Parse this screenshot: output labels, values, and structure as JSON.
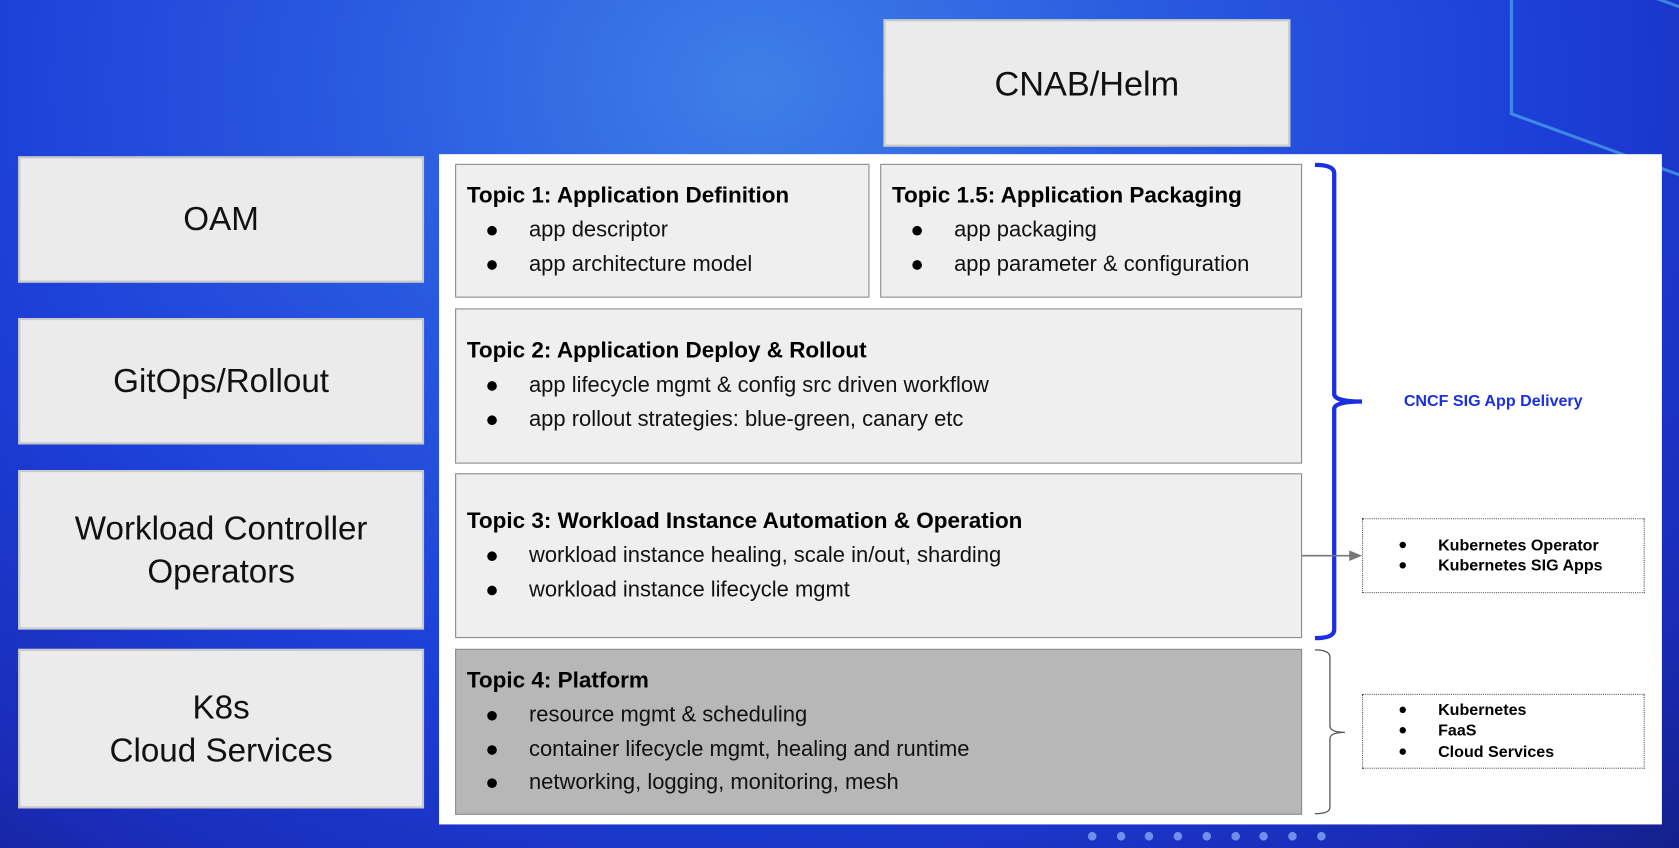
{
  "top_box": {
    "label": "CNAB/Helm"
  },
  "left_boxes": [
    {
      "label": "OAM"
    },
    {
      "label": "GitOps/Rollout"
    },
    {
      "label": "Workload Controller\nOperators"
    },
    {
      "label": "K8s\nCloud Services"
    }
  ],
  "topics": [
    {
      "title": "Topic 1: Application Definition",
      "items": [
        "app descriptor",
        "app architecture model"
      ]
    },
    {
      "title": "Topic 1.5: Application Packaging",
      "items": [
        "app packaging",
        "app parameter & configuration"
      ]
    },
    {
      "title": "Topic 2: Application Deploy & Rollout",
      "items": [
        "app lifecycle mgmt & config src driven workflow",
        "app rollout strategies: blue-green, canary etc"
      ]
    },
    {
      "title": "Topic 3: Workload Instance Automation & Operation",
      "items": [
        "workload instance healing, scale in/out, sharding",
        "workload instance lifecycle mgmt"
      ]
    },
    {
      "title": "Topic 4: Platform",
      "items": [
        "resource mgmt & scheduling",
        "container lifecycle mgmt, healing and runtime",
        "networking, logging, monitoring, mesh"
      ]
    }
  ],
  "brace_label": "CNCF SIG App Delivery",
  "side_boxes": [
    {
      "items": [
        "Kubernetes Operator",
        "Kubernetes SIG Apps"
      ]
    },
    {
      "items": [
        "Kubernetes",
        "FaaS",
        "Cloud Services"
      ]
    }
  ],
  "colors": {
    "brace": "#1a2fe0",
    "topic4_bg": "#b7b7b7",
    "topic_bg": "#efefef"
  }
}
